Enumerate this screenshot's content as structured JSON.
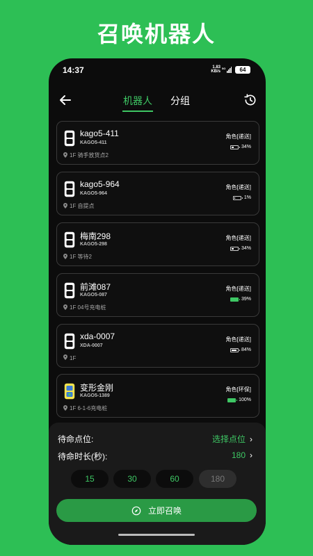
{
  "headline": "召唤机器人",
  "status": {
    "time": "14:37",
    "net_speed": "1.83",
    "net_unit": "KB/s",
    "net_type": "5G",
    "battery": "64"
  },
  "tabs": {
    "robots": "机器人",
    "groups": "分组"
  },
  "robots": [
    {
      "name": "kago5-411",
      "code": "KAGO5-411",
      "location": "1F 骑手放货点2",
      "role": "角色[递送]",
      "battery_text": "34%",
      "battery_level": 0.34,
      "charging": false,
      "avatar": "robot-icon"
    },
    {
      "name": "kago5-964",
      "code": "KAGO5-964",
      "location": "1F 自提点",
      "role": "角色[递送]",
      "battery_text": "1%",
      "battery_level": 0.01,
      "charging": false,
      "avatar": "robot-icon"
    },
    {
      "name": "梅南298",
      "code": "KAGO5-298",
      "location": "1F 等待2",
      "role": "角色[递送]",
      "battery_text": "34%",
      "battery_level": 0.34,
      "charging": false,
      "avatar": "robot-icon"
    },
    {
      "name": "前滩087",
      "code": "KAGO5-087",
      "location": "1F 04号充电桩",
      "role": "角色[递送]",
      "battery_text": "39%",
      "battery_level": 0.39,
      "charging": true,
      "avatar": "robot-icon"
    },
    {
      "name": "xda-0007",
      "code": "XDA-0007",
      "location": "1F",
      "role": "角色[递送]",
      "battery_text": "84%",
      "battery_level": 0.84,
      "charging": false,
      "avatar": "robot-icon"
    },
    {
      "name": "变形金刚",
      "code": "KAGO5-1389",
      "location": "1F 6-1-6充电桩",
      "role": "角色[环保]",
      "battery_text": "100%",
      "battery_level": 1.0,
      "charging": true,
      "avatar": "cleaning-robot-icon"
    }
  ],
  "panel": {
    "standby_point_label": "待命点位:",
    "standby_point_value": "选择点位",
    "standby_duration_label": "待命时长(秒):",
    "standby_duration_value": "180",
    "chevron": "›",
    "durations": [
      "15",
      "30",
      "60",
      "180"
    ],
    "selected_duration": "180",
    "summon_label": "立即召唤"
  },
  "colors": {
    "brand": "#2dbf55",
    "accent": "#3ec764",
    "button": "#2a9a45",
    "background": "#0c0c0c"
  }
}
